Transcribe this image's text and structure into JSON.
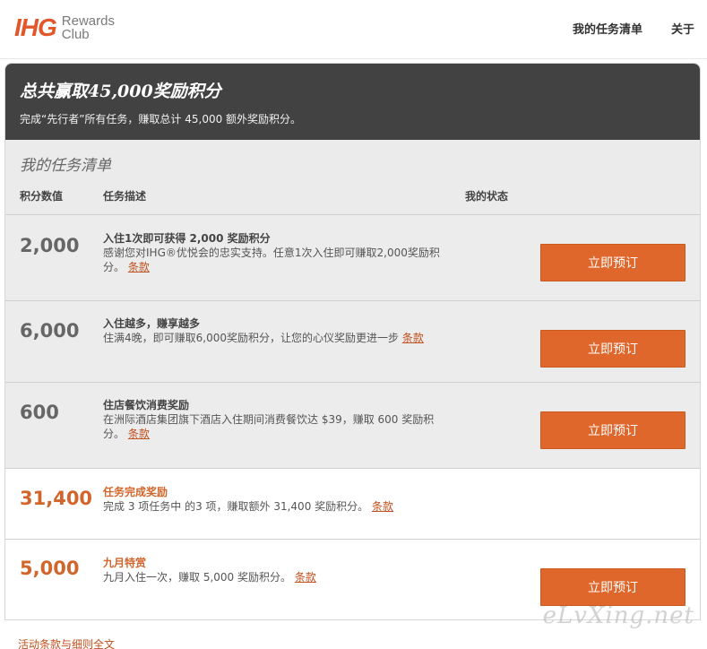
{
  "header": {
    "logo_mark": "IHG",
    "logo_line1": "Rewards",
    "logo_line2": "Club",
    "nav": [
      "我的任务清单",
      "关于"
    ]
  },
  "hero": {
    "title": "总共赢取45,000奖励积分",
    "subtitle": "完成“先行者”所有任务，赚取总计 45,000 额外奖励积分。"
  },
  "list": {
    "title": "我的任务清单",
    "columns": [
      "积分数值",
      "任务描述",
      "我的状态"
    ]
  },
  "rows": [
    {
      "points": "2,000",
      "title": "入住1次即可获得 2,000 奖励积分",
      "desc": "感谢您对IHG®优悦会的忠实支持。任意1次入住即可赚取2,000奖励积分。",
      "terms": "条款",
      "button": "立即预订"
    },
    {
      "points": "6,000",
      "title": "入住越多，赚享越多",
      "desc": "住满4晚，即可赚取6,000奖励积分，让您的心仪奖励更进一步",
      "terms": "条款",
      "button": "立即预订"
    },
    {
      "points": "600",
      "title": "住店餐饮消费奖励",
      "desc": "在洲际酒店集团旗下酒店入住期间消费餐饮达 $39，赚取 600 奖励积分。",
      "terms": "条款",
      "button": "立即预订"
    },
    {
      "points": "31,400",
      "title": "任务完成奖励",
      "desc": "完成 3 项任务中 的3 项，赚取额外 31,400 奖励积分。",
      "terms": "条款"
    },
    {
      "points": "5,000",
      "title": "九月特赏",
      "desc": "九月入住一次，赚取 5,000 奖励积分。",
      "terms": "条款",
      "button": "立即预订"
    }
  ],
  "footer": {
    "link": "活动条款与细则全文"
  },
  "watermark": "eLvXing.net",
  "colors": {
    "accent": "#e0672c",
    "hero_bg": "#424242",
    "row_gray": "#ececec"
  }
}
